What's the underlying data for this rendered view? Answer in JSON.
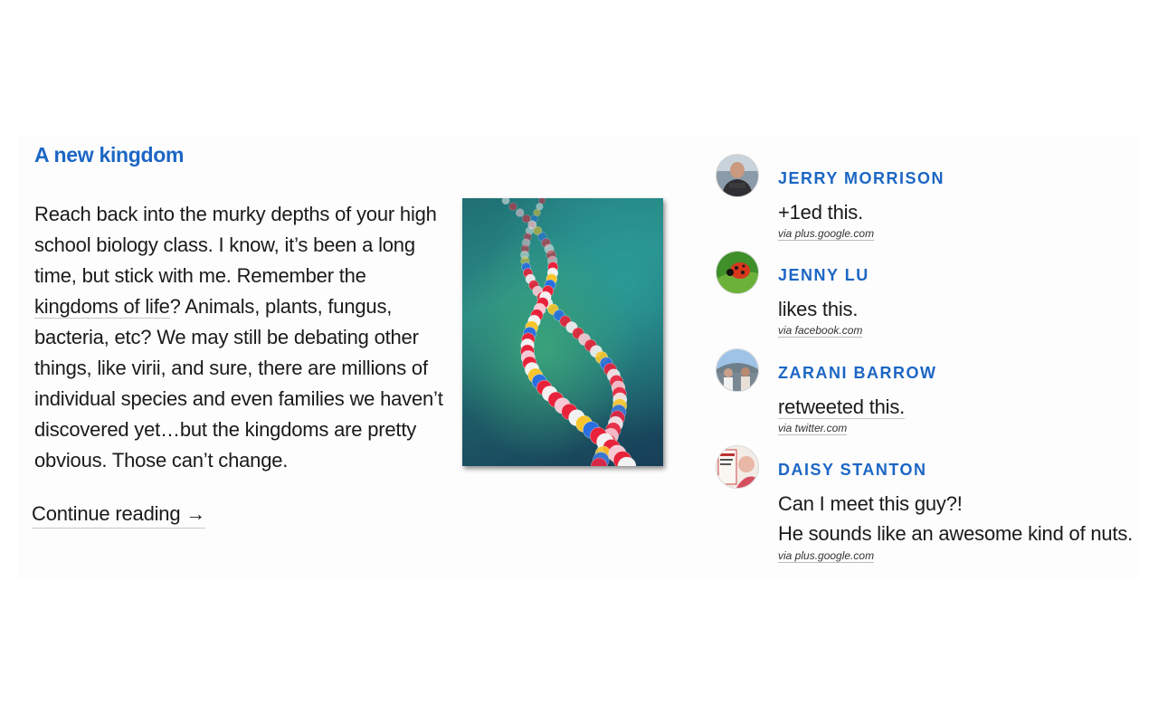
{
  "post": {
    "title": "A new kingdom",
    "excerpt_before_link": "Reach back into the murky depths of your high school biology class. I know, it’s been a long time, but stick with me. Remember the ",
    "excerpt_link": "kingdoms of life",
    "excerpt_after_link": "? Animals, plants, fungus, bacteria, etc? We may still be debating other things, like virii, and sure, there are millions of individual species and even families we haven’t discovered yet…but the kingdoms are pretty obvious. Those can’t change.",
    "continue_label": "Continue reading →",
    "image_icon": "dna-beads-photo"
  },
  "activity": [
    {
      "name": "Jerry Morrison",
      "action": "+1ed this.",
      "via": "via plus.google.com",
      "avatar_icon": "person-photo"
    },
    {
      "name": "Jenny Lu",
      "action": "likes this.",
      "via": "via facebook.com",
      "avatar_icon": "ladybug-photo"
    },
    {
      "name": "Zarani Barrow",
      "action": "retweeted this.",
      "via": "via twitter.com",
      "avatar_icon": "group-photo"
    },
    {
      "name": "Daisy Stanton",
      "action_line1": "Can I meet this guy?!",
      "action_line2": "He sounds like an awesome kind of nuts.",
      "via": "via plus.google.com",
      "avatar_icon": "coffee-sign-photo"
    }
  ],
  "colors": {
    "accent": "#1c66c4",
    "text": "#1a1a1a"
  }
}
